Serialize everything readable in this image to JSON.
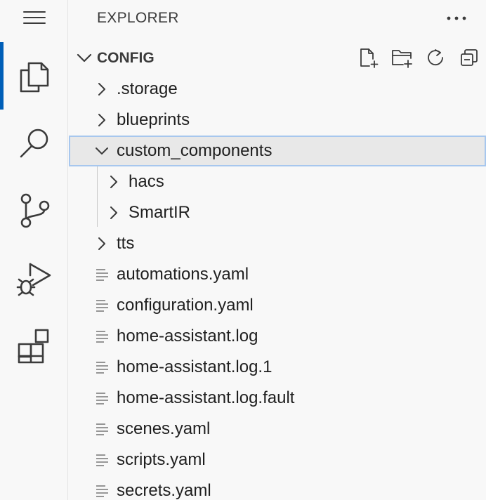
{
  "sidebar": {
    "title": "EXPLORER",
    "section": {
      "title": "CONFIG",
      "actions": [
        {
          "icon": "new-file-icon"
        },
        {
          "icon": "new-folder-icon"
        },
        {
          "icon": "refresh-icon"
        },
        {
          "icon": "collapse-all-icon"
        }
      ]
    },
    "tree": [
      {
        "label": ".storage",
        "type": "folder",
        "expanded": false,
        "depth": 0
      },
      {
        "label": "blueprints",
        "type": "folder",
        "expanded": false,
        "depth": 0
      },
      {
        "label": "custom_components",
        "type": "folder",
        "expanded": true,
        "depth": 0,
        "selected": true
      },
      {
        "label": "hacs",
        "type": "folder",
        "expanded": false,
        "depth": 1
      },
      {
        "label": "SmartIR",
        "type": "folder",
        "expanded": false,
        "depth": 1
      },
      {
        "label": "tts",
        "type": "folder",
        "expanded": false,
        "depth": 0
      },
      {
        "label": "automations.yaml",
        "type": "file",
        "depth": 0
      },
      {
        "label": "configuration.yaml",
        "type": "file",
        "depth": 0
      },
      {
        "label": "home-assistant.log",
        "type": "file",
        "depth": 0
      },
      {
        "label": "home-assistant.log.1",
        "type": "file",
        "depth": 0
      },
      {
        "label": "home-assistant.log.fault",
        "type": "file",
        "depth": 0
      },
      {
        "label": "scenes.yaml",
        "type": "file",
        "depth": 0
      },
      {
        "label": "scripts.yaml",
        "type": "file",
        "depth": 0
      },
      {
        "label": "secrets.yaml",
        "type": "file",
        "depth": 0
      }
    ]
  },
  "activity_bar": {
    "items": [
      {
        "icon": "menu-icon"
      },
      {
        "icon": "explorer-icon",
        "active": true
      },
      {
        "icon": "search-icon"
      },
      {
        "icon": "source-control-icon"
      },
      {
        "icon": "run-debug-icon"
      },
      {
        "icon": "extensions-icon"
      }
    ]
  },
  "colors": {
    "accent": "#005fb8",
    "selection_border": "#a7c7ee",
    "selection_bg": "#e8e8e8",
    "icon": "#3b3b3b"
  }
}
